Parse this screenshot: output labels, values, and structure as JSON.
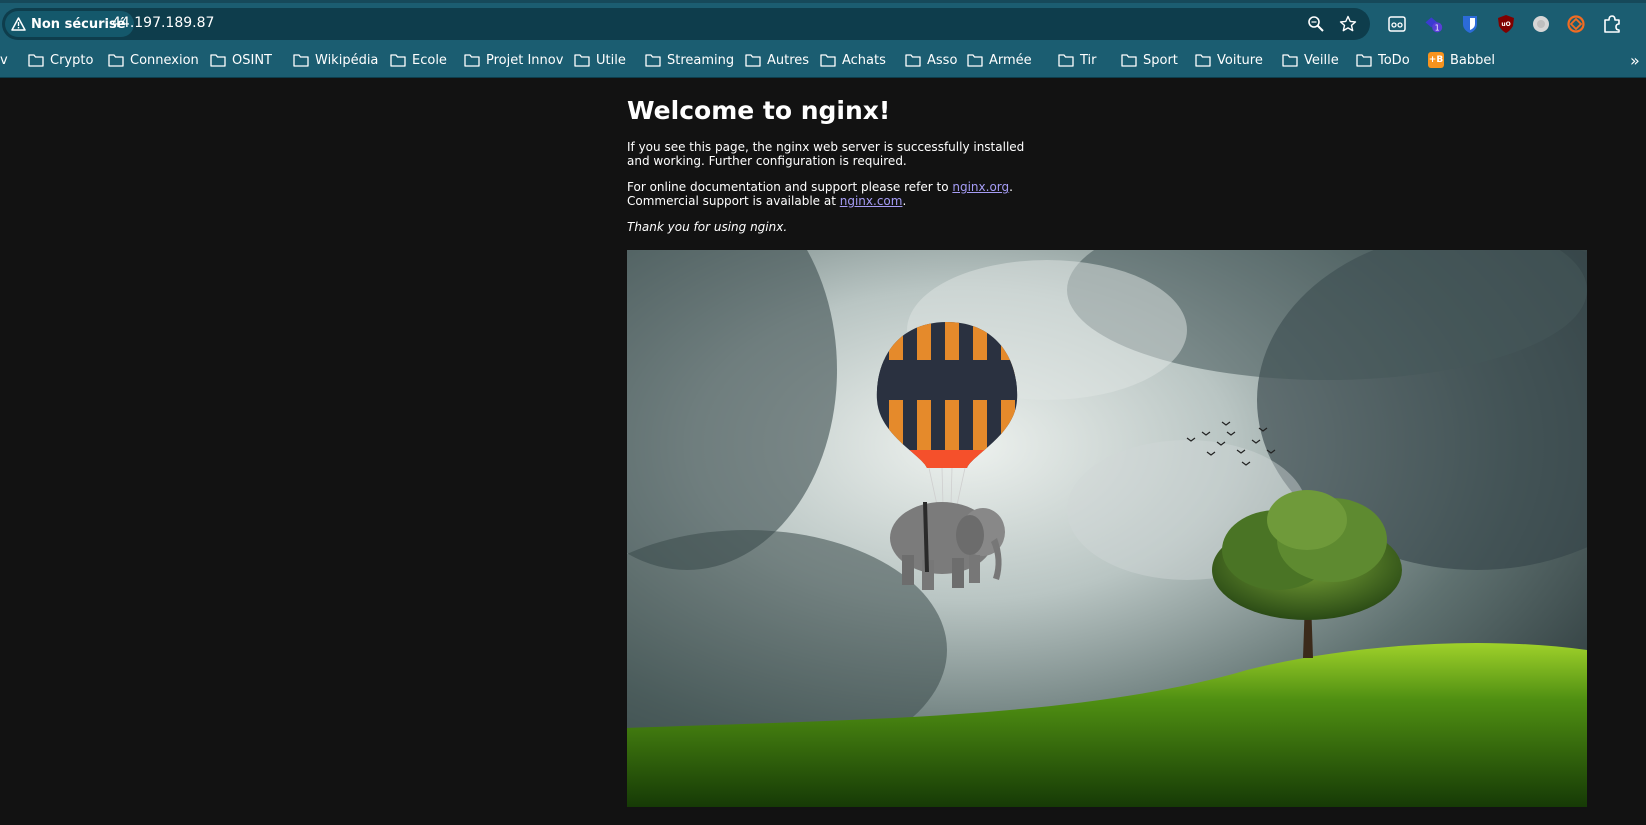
{
  "toolbar": {
    "security_label": "Non sécurisé",
    "url": "44.197.189.87",
    "icons": [
      "zoom-icon",
      "star-icon",
      "reader-mode-icon",
      "extension-badge-icon",
      "bitwarden-icon",
      "ublock-icon",
      "grey-extension-icon",
      "orange-extension-icon",
      "extensions-puzzle-icon"
    ],
    "extension_badge_count": "1"
  },
  "bookmarks": {
    "partial": "v",
    "items": [
      "Crypto",
      "Connexion",
      "OSINT",
      "Wikipédia",
      "Ecole",
      "Projet Innov",
      "Utile",
      "Streaming",
      "Autres",
      "Achats",
      "Asso",
      "Armée",
      "Tir",
      "Sport",
      "Voiture",
      "Veille",
      "ToDo",
      "Babbel"
    ],
    "babbel_icon_text": "+B",
    "overflow": "»"
  },
  "page": {
    "title": "Welcome to nginx!",
    "p1": "If you see this page, the nginx web server is successfully installed and working. Further configuration is required.",
    "p2_prefix": "For online documentation and support please refer to ",
    "link_org": "nginx.org",
    "p2_mid": ".",
    "p2_line2": "Commercial support is available at ",
    "link_com": "nginx.com",
    "p2_end": ".",
    "thanks": "Thank you for using nginx."
  },
  "colors": {
    "toolbar_bg": "#1b5d71",
    "omnibox_bg": "#0e3d4c",
    "page_bg": "#121212",
    "link": "#a59cf5"
  }
}
